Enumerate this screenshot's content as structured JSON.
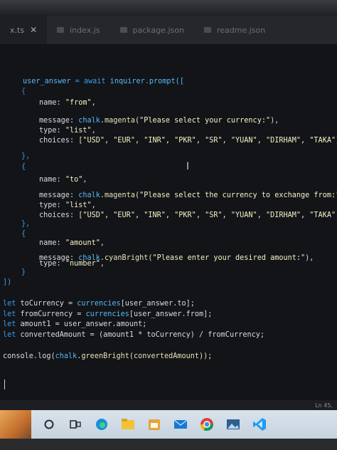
{
  "tabs": [
    {
      "label": "x.ts",
      "active": true
    },
    {
      "label": "index.js",
      "active": false
    },
    {
      "label": "package.json",
      "active": false
    },
    {
      "label": "readme.json",
      "active": false
    }
  ],
  "code": {
    "l1_a": "user_answer",
    "l1_b": " = ",
    "l1_c": "await",
    "l1_d": " inquirer.prompt([",
    "l2": "{",
    "l3_k": "name",
    "l3_v": "\"from\"",
    "l4_k": "message",
    "l4_fn": "chalk",
    "l4_m": ".magenta(",
    "l4_s": "\"Please select your currency:\"",
    "l4_e": "),",
    "l5_k": "type",
    "l5_v": "\"list\"",
    "l6_k": "choices",
    "l6_v": "[\"USD\", \"EUR\", \"INR\", \"PKR\", \"SR\", \"YUAN\", \"DIRHAM\", \"TAKA\"]",
    "l7": "},",
    "l8": "{",
    "l9_k": "name",
    "l9_v": "\"to\"",
    "l10_k": "message",
    "l10_fn": "chalk",
    "l10_m": ".magenta(",
    "l10_s": "\"Please select the currency to exchange from:\")",
    "l11_k": "type",
    "l11_v": "\"list\"",
    "l12_k": "choices",
    "l12_v": "[\"USD\", \"EUR\", \"INR\", \"PKR\", \"SR\", \"YUAN\", \"DIRHAM\", \"TAKA\"]",
    "l13": "},",
    "l14": "{",
    "l15_k": "name",
    "l15_v": "\"amount\"",
    "l16_k": "message",
    "l16_fn": "chalk",
    "l16_m": ".cyanBright(",
    "l16_s": "\"Please enter your desired amount:\"",
    "l16_e": "),",
    "l17_k": "type",
    "l17_v": "\"number\"",
    "l18": "}",
    "l19": "])",
    "l20_kw": "let",
    "l20_a": " toCurrency = ",
    "l20_b": "currencies",
    "l20_c": "[user_answer.to];",
    "l21_kw": "let",
    "l21_a": " fromCurrency = ",
    "l21_b": "currencies",
    "l21_c": "[user_answer.from];",
    "l22_kw": "let",
    "l22_a": " amount1 = user_answer.amount;",
    "l23_kw": "let",
    "l23_a": " convertedAmount = (amount1 * toCurrency) / fromCurrency;",
    "l24_a": "console.log(",
    "l24_b": "chalk",
    "l24_c": ".greenBright(convertedAmount));"
  },
  "ibeam": "I",
  "statusbar": {
    "position": "Ln 45,"
  },
  "taskbar": {
    "items": [
      "search-icon",
      "task-view-icon",
      "edge-icon",
      "file-explorer-icon",
      "calendar-icon",
      "mail-icon",
      "chrome-icon",
      "photos-icon",
      "vscode-icon"
    ]
  }
}
